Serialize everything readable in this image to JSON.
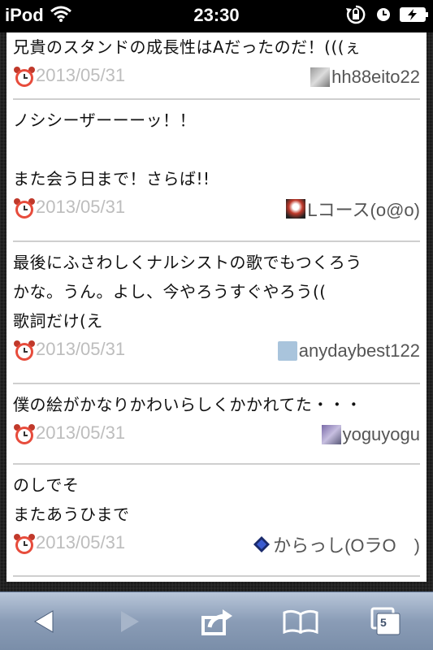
{
  "status_bar": {
    "device": "iPod",
    "time": "23:30",
    "icons": [
      "wifi-icon",
      "rotation-lock-icon",
      "alarm-clock-icon",
      "battery-charging-icon"
    ]
  },
  "posts": [
    {
      "text": "兄貴のスタンドの成長性はAだったのだ！(((ぇ",
      "date": "2013/05/31",
      "user": "hh88eito22"
    },
    {
      "text": "ノシシーザーーーッ！！\n\nまた会う日まで！さらば!!",
      "date": "2013/05/31",
      "user": "Lコース(o@o)"
    },
    {
      "text": "最後にふさわしくナルシストの歌でもつくろう\nかな。うん。よし、今やろうすぐやろう((\n歌詞だけ(え",
      "date": "2013/05/31",
      "user": "anydaybest122"
    },
    {
      "text": "僕の絵がかなりかわいらしくかかれてた・・・",
      "date": "2013/05/31",
      "user": "yoguyogu"
    },
    {
      "text": "のしでそ\nまたあうひまで",
      "date": "2013/05/31",
      "user": "からっし(OラO　)"
    }
  ],
  "toolbar": {
    "tab_count": "5",
    "buttons": [
      "back-icon",
      "forward-icon",
      "share-icon",
      "bookmarks-icon",
      "tabs-icon"
    ]
  },
  "colors": {
    "toolbar": "#8a9cb6",
    "date_text": "#bdbdbd",
    "divider": "#cfcfcf"
  }
}
